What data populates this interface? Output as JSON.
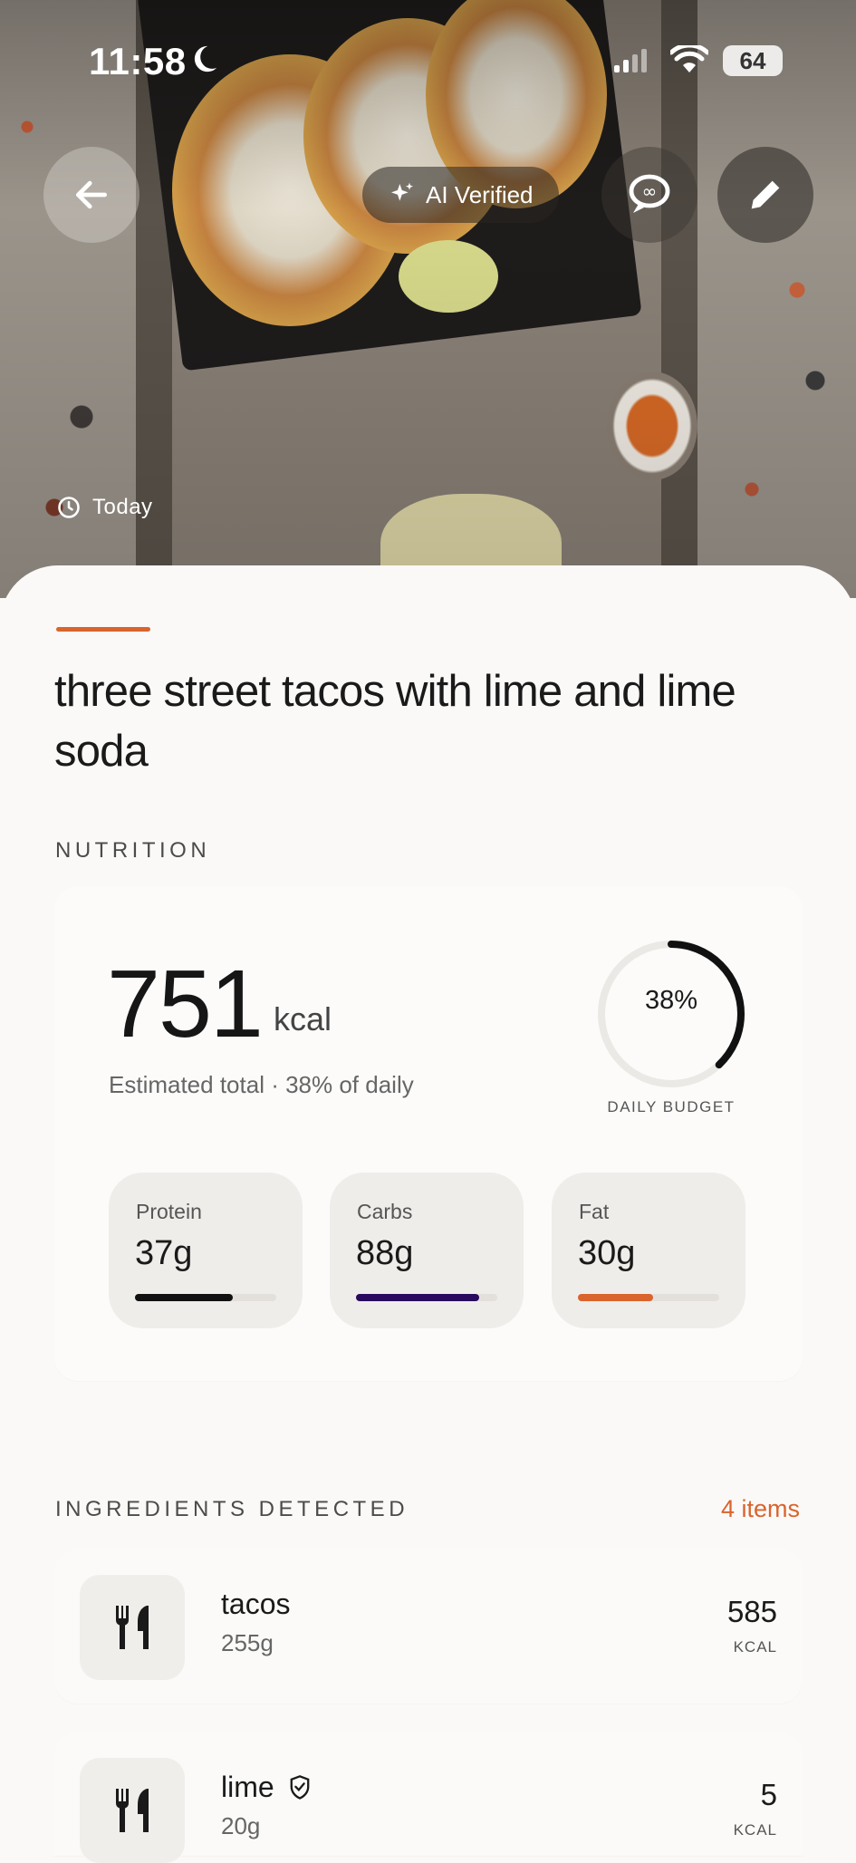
{
  "status_bar": {
    "time": "11:58",
    "battery": "64"
  },
  "header": {
    "ai_badge": "AI Verified",
    "timestamp": "Today"
  },
  "meal": {
    "title": "three street tacos with lime and lime soda"
  },
  "nutrition": {
    "section_label": "NUTRITION",
    "calories": "751",
    "calories_unit": "kcal",
    "summary": "Estimated total · 38% of daily",
    "daily_budget_percent_text": "38%",
    "daily_budget_fraction": 0.38,
    "daily_budget_label": "DAILY BUDGET",
    "macros": [
      {
        "name": "Protein",
        "value": "37g",
        "fill": 0.69,
        "color": "#111111"
      },
      {
        "name": "Carbs",
        "value": "88g",
        "fill": 0.87,
        "color": "#2a0a5e"
      },
      {
        "name": "Fat",
        "value": "30g",
        "fill": 0.53,
        "color": "#d9642d"
      }
    ]
  },
  "ingredients": {
    "section_label": "INGREDIENTS DETECTED",
    "count": "4 items",
    "items": [
      {
        "name": "tacos",
        "weight": "255g",
        "kcal": "585",
        "kcal_unit": "KCAL",
        "verified": false
      },
      {
        "name": "lime",
        "weight": "20g",
        "kcal": "5",
        "kcal_unit": "KCAL",
        "verified": true
      }
    ]
  },
  "colors": {
    "accent": "#d9642d",
    "ring": "#111111"
  },
  "icons": [
    "back-arrow-icon",
    "sparkles-icon",
    "chat-bubble-icon",
    "pencil-icon",
    "clock-icon",
    "fork-knife-icon",
    "shield-check-icon",
    "moon-icon",
    "signal-icon",
    "wifi-icon"
  ]
}
